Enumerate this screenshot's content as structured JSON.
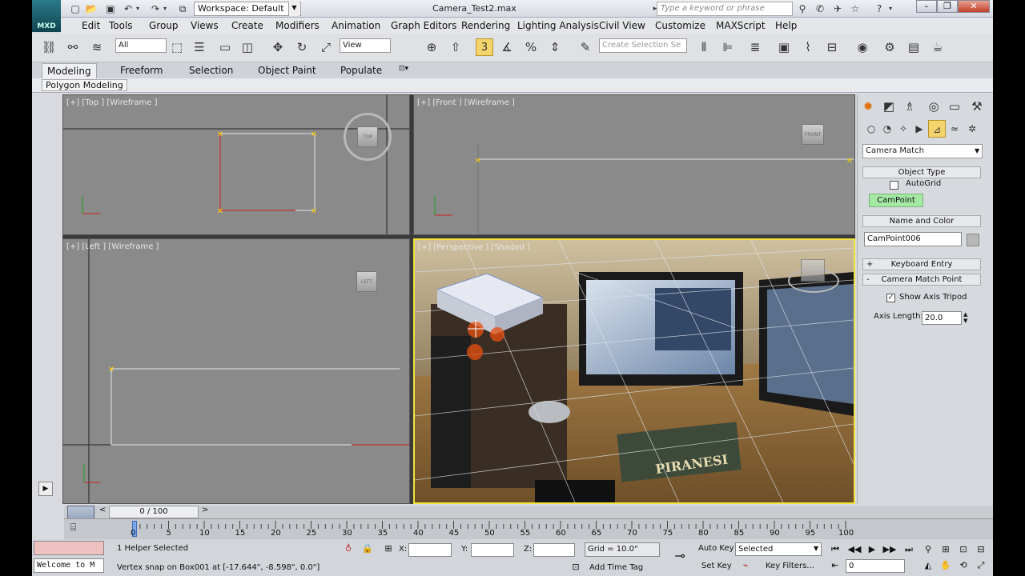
{
  "app": {
    "logo": "MXD",
    "title": "Camera_Test2.max"
  },
  "workspace": {
    "value": "Workspace: Default"
  },
  "search": {
    "placeholder": "Type a keyword or phrase"
  },
  "window_buttons": [
    "–",
    "❐",
    "✕"
  ],
  "menus": [
    "Edit",
    "Tools",
    "Group",
    "Views",
    "Create",
    "Modifiers",
    "Animation",
    "Graph Editors",
    "Rendering",
    "Lighting Analysis",
    "Civil View",
    "Customize",
    "MAXScript",
    "Help"
  ],
  "toolbar": {
    "selection_filter": "All",
    "ref_coord": "View",
    "snap_value": "3",
    "named_selection_placeholder": "Create Selection Se"
  },
  "ribbon": {
    "tabs": [
      "Modeling",
      "Freeform",
      "Selection",
      "Object Paint",
      "Populate"
    ],
    "active": "Modeling",
    "sub": "Polygon Modeling"
  },
  "viewports": {
    "top": {
      "label": "[+] [Top ] [Wireframe ]",
      "cube": "TOP"
    },
    "front": {
      "label": "[+] [Front ] [Wireframe ]",
      "cube": "FRONT"
    },
    "left": {
      "label": "[+] [Left ] [Wireframe ]",
      "cube": "LEFT"
    },
    "perspective": {
      "label": "[+] [Perspective ] [Shaded ]",
      "book_title": "PIRANESI"
    }
  },
  "command_panel": {
    "dropdown": "Camera Match",
    "object_type": {
      "title": "Object Type",
      "autogrid": "AutoGrid",
      "autogrid_checked": false,
      "button": "CamPoint"
    },
    "name_color": {
      "title": "Name and Color",
      "name": "CamPoint006"
    },
    "keyboard_entry": {
      "title": "Keyboard Entry",
      "sign": "+"
    },
    "camera_match_point": {
      "title": "Camera Match Point",
      "sign": "-",
      "show_axis_tripod": "Show Axis Tripod",
      "show_axis_checked": true,
      "axis_length_label": "Axis Length:",
      "axis_length": "20.0"
    }
  },
  "timeline": {
    "frame_display": "0 / 100",
    "current_frame": 0,
    "total_frames": 100,
    "ticks": [
      "0",
      "5",
      "10",
      "15",
      "20",
      "25",
      "30",
      "35",
      "40",
      "45",
      "50",
      "55",
      "60",
      "65",
      "70",
      "75",
      "80",
      "85",
      "90",
      "95",
      "100"
    ]
  },
  "status": {
    "maxscript": "Welcome to M",
    "selected": "1 Helper Selected",
    "prompt": "Vertex snap on Box001 at [-17.644\", -8.598\", 0.0\"]",
    "x_label": "X:",
    "y_label": "Y:",
    "z_label": "Z:",
    "grid": "Grid = 10.0\"",
    "add_time_tag": "Add Time Tag",
    "auto_key": "Auto Key",
    "set_key": "Set Key",
    "key_mode": "Selected",
    "key_filters": "Key Filters...",
    "frame": "0"
  }
}
